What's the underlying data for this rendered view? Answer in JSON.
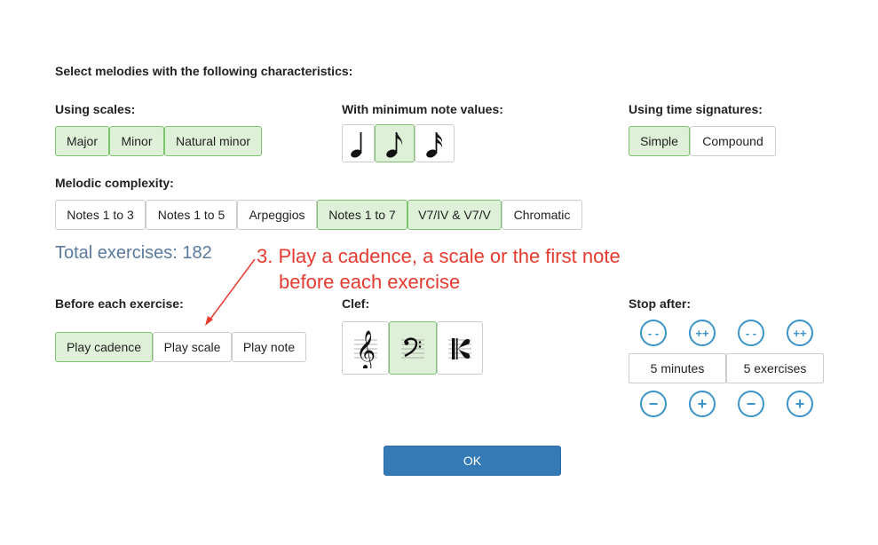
{
  "header": {
    "title": "Select melodies with the following characteristics:"
  },
  "scales": {
    "heading": "Using scales:",
    "options": [
      {
        "label": "Major",
        "selected": true
      },
      {
        "label": "Minor",
        "selected": true
      },
      {
        "label": "Natural minor",
        "selected": true
      }
    ]
  },
  "note_values": {
    "heading": "With minimum note values:",
    "options": [
      {
        "icon": "quarter-note-icon",
        "selected": false
      },
      {
        "icon": "eighth-note-icon",
        "selected": true
      },
      {
        "icon": "sixteenth-note-icon",
        "selected": false
      }
    ]
  },
  "time_signatures": {
    "heading": "Using time signatures:",
    "options": [
      {
        "label": "Simple",
        "selected": true
      },
      {
        "label": "Compound",
        "selected": false
      }
    ]
  },
  "complexity": {
    "heading": "Melodic complexity:",
    "options": [
      {
        "label": "Notes 1 to 3",
        "selected": false
      },
      {
        "label": "Notes 1 to 5",
        "selected": false
      },
      {
        "label": "Arpeggios",
        "selected": false
      },
      {
        "label": "Notes 1 to 7",
        "selected": true
      },
      {
        "label": "V7/IV & V7/V",
        "selected": true
      },
      {
        "label": "Chromatic",
        "selected": false
      }
    ]
  },
  "total": {
    "text": "Total exercises: 182"
  },
  "annotation": {
    "line1": "3. Play a cadence, a scale or the first note",
    "line2": "before each exercise"
  },
  "before": {
    "heading": "Before each exercise:",
    "options": [
      {
        "label": "Play cadence",
        "selected": true
      },
      {
        "label": "Play scale",
        "selected": false
      },
      {
        "label": "Play note",
        "selected": false
      }
    ]
  },
  "clef": {
    "heading": "Clef:",
    "options": [
      {
        "icon": "treble-clef-icon",
        "selected": false
      },
      {
        "icon": "bass-clef-icon",
        "selected": true
      },
      {
        "icon": "alto-clef-icon",
        "selected": false
      }
    ]
  },
  "stop_after": {
    "heading": "Stop after:",
    "fast_decrease": "- -",
    "fast_increase": "++",
    "decrease": "−",
    "increase": "+",
    "minutes": "5 minutes",
    "exercises": "5 exercises"
  },
  "ok_label": "OK",
  "colors": {
    "selected_bg": "#dff0d8",
    "selected_border": "#7cc36e",
    "primary": "#337ab7",
    "accent_blue": "#3a93c9",
    "annotation_red": "#e53a2f",
    "total_text": "#5a7a9e"
  }
}
